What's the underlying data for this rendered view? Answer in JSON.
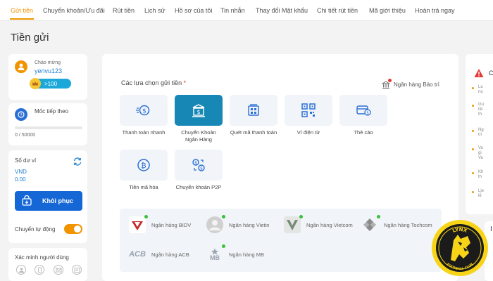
{
  "nav": {
    "tabs": [
      {
        "label": "Gửi tiền",
        "active": true
      },
      {
        "label": "Chuyển khoản/Ưu đãi"
      },
      {
        "label": "Rút tiền"
      },
      {
        "label": "Lịch sử"
      },
      {
        "label": "Hồ sơ của tôi"
      },
      {
        "label": "Tin nhắn"
      },
      {
        "label": "Thay đổi Mật khẩu"
      },
      {
        "label": "Chi tiết rút tiền"
      },
      {
        "label": "Mã giới thiệu"
      },
      {
        "label": "Hoàn trả ngay"
      }
    ]
  },
  "page": {
    "title": "Tiền gửi"
  },
  "user": {
    "welcome": "Chào mừng",
    "username": "yenvu123",
    "vip_badge": ">100"
  },
  "progress": {
    "label": "Mốc tiếp theo",
    "value_text": "0 / 50000",
    "current": 0,
    "target": 50000
  },
  "balance": {
    "label": "Số dư ví",
    "currency": "VND",
    "value": "0.00",
    "restore_label": "Khôi phục",
    "auto_transfer_label": "Chuyển tự động",
    "auto_transfer_on": true
  },
  "verify": {
    "label": "Xác minh người dùng",
    "icons": [
      "user-icon",
      "phone-icon",
      "email-icon",
      "id-card-icon"
    ]
  },
  "deposit": {
    "section_title": "Các lựa chọn gửi tiền",
    "required_mark": "*",
    "maintenance_label": "Ngân hàng Bảo trì",
    "methods": [
      {
        "label": "Thanh toán nhanh",
        "icon": "fast-payment-icon",
        "active": false
      },
      {
        "label": "Chuyển Khoản Ngân Hàng",
        "icon": "bank-transfer-icon",
        "active": true
      },
      {
        "label": "Quét mã thanh toán",
        "icon": "scan-code-icon",
        "active": false
      },
      {
        "label": "Ví điện tử",
        "icon": "qr-wallet-icon",
        "active": false
      },
      {
        "label": "Thẻ cào",
        "icon": "scratch-card-icon",
        "active": false
      },
      {
        "label": "Tiền mã hóa",
        "icon": "crypto-icon",
        "active": false
      },
      {
        "label": "Chuyển khoản P2P",
        "icon": "p2p-transfer-icon",
        "active": false
      }
    ],
    "banks": [
      {
        "name": "Ngân hàng BIDV",
        "logo": "bidv-logo",
        "online": true
      },
      {
        "name": "Ngân hàng Vietin",
        "logo": "vietin-logo",
        "online": true
      },
      {
        "name": "Ngân hàng Vietcom",
        "logo": "vietcom-logo",
        "online": true
      },
      {
        "name": "Ngân hàng Tochcom",
        "logo": "tochcom-logo",
        "online": true
      },
      {
        "name": "Ngân hàng ACB",
        "logo": "acb-logo",
        "online": false
      },
      {
        "name": "Ngân hàng MB",
        "logo": "mb-logo",
        "online": true
      }
    ],
    "acb_logo_text": "ACB",
    "mb_logo_text": "MB"
  },
  "notice": {
    "head": "C",
    "items": [
      "Lu\nnọ",
      "Gu\ntiề\nth",
      "Ng\ntrì",
      "Vu\ngi\nVu",
      "Kh\nth",
      "Lie\nlễ"
    ]
  },
  "right_card2": {
    "text": "I"
  },
  "logo": {
    "top_text": "LYNX",
    "bottom_text": "FOOTBALL CLUB"
  },
  "colors": {
    "accent": "#f29400",
    "primary_blue": "#1567d5",
    "active_method": "#1787b5",
    "link_blue": "#1f7fd0"
  }
}
